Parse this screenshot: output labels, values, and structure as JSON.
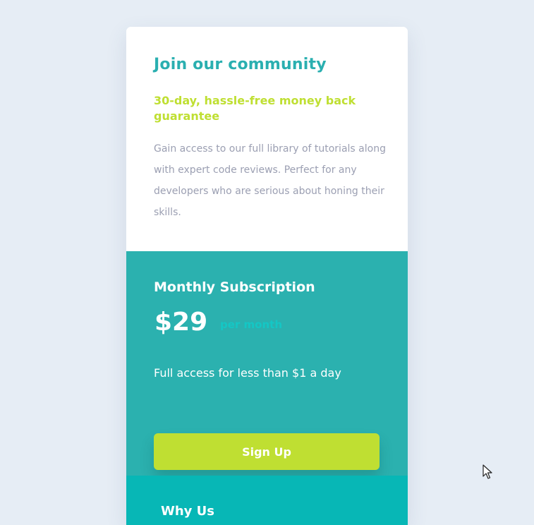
{
  "card": {
    "title": "Join our community",
    "guarantee": "30-day, hassle-free money back guarantee",
    "description": "Gain access to our full library of tutorials along with expert code reviews. Perfect for any developers who are serious about honing their skills."
  },
  "subscription": {
    "title": "Monthly Subscription",
    "price": "$29",
    "period": "per month",
    "access": "Full access for less than $1 a day",
    "button_label": "Sign Up"
  },
  "why_us": {
    "title": "Why Us"
  },
  "colors": {
    "page_background": "#e6edf5",
    "title_teal": "#2aafb0",
    "accent_lime": "#bfdf32",
    "body_gray": "#9b9fb2",
    "subscription_teal": "#2bb1af",
    "period_cyan": "#14c7c5",
    "why_teal": "#07b7b6"
  },
  "icons": {
    "cursor": "mouse-pointer-icon"
  }
}
